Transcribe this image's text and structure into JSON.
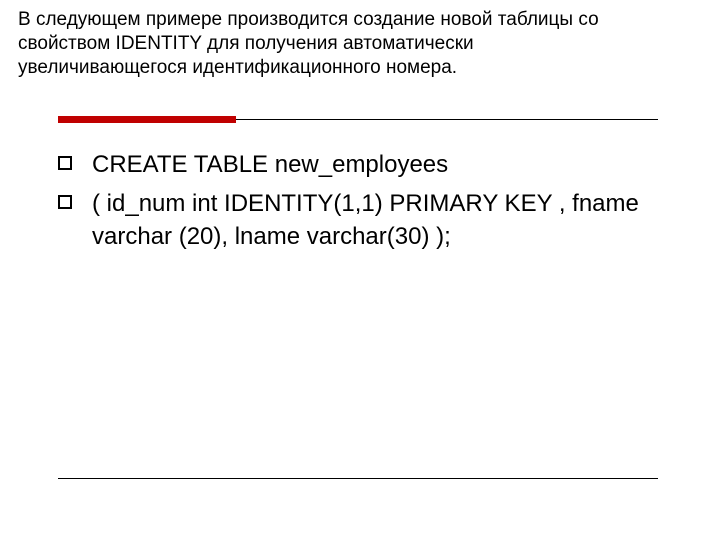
{
  "title": "В следующем примере производится создание новой таблицы со свойством IDENTITY для получения автоматически увеличивающегося идентификационного номера.",
  "content": {
    "items": [
      "CREATE TABLE  new_employees",
      " ( id_num int IDENTITY(1,1) PRIMARY KEY , fname varchar (20), lname varchar(30) );"
    ]
  }
}
